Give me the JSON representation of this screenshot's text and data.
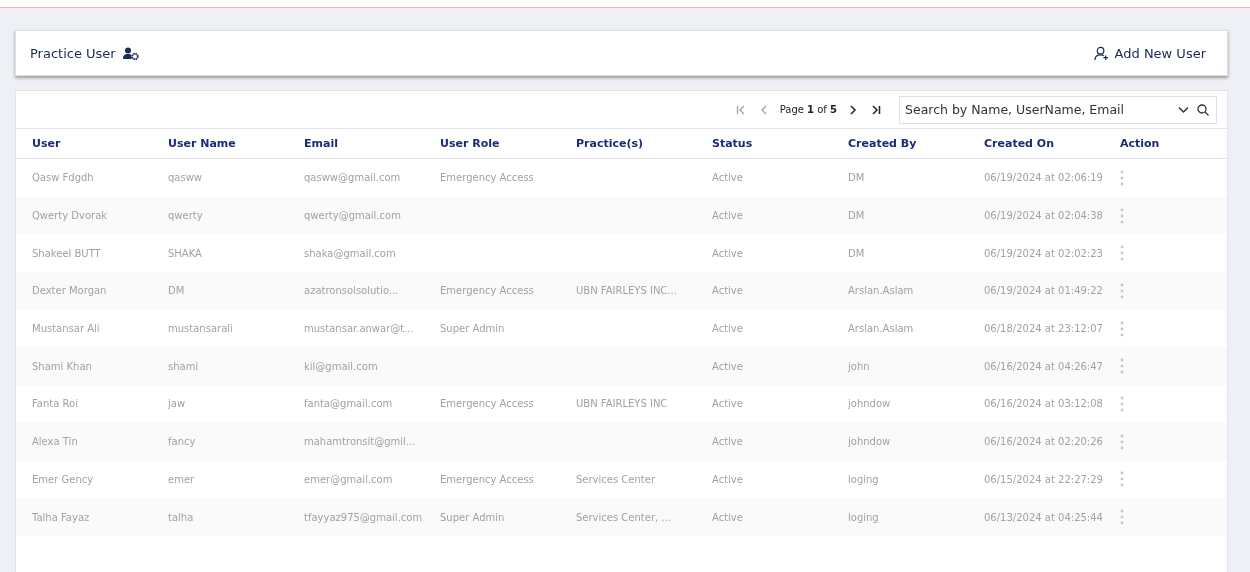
{
  "header": {
    "title": "Practice User",
    "add_button": "Add New User"
  },
  "pagination": {
    "label": "Page",
    "current": "1",
    "of": "of",
    "total": "5"
  },
  "search": {
    "placeholder": "Search by Name, UserName, Email"
  },
  "table": {
    "columns": [
      "User",
      "User Name",
      "Email",
      "User Role",
      "Practice(s)",
      "Status",
      "Created By",
      "Created On",
      "Action"
    ],
    "rows": [
      {
        "user": "Qasw Fdgdh",
        "user_name": "qasww",
        "email": "qasww@gmail.com",
        "user_role": "Emergency Access",
        "status": "Active",
        "created_by": "DM",
        "created_on": "06/19/2024 at 02:06:19"
      },
      {
        "user": "Qwerty Dvorak",
        "user_name": "qwerty",
        "email": "qwerty@gmail.com",
        "status": "Active",
        "created_by": "DM",
        "created_on": "06/19/2024 at 02:04:38"
      },
      {
        "user": "Shakeel BUTT",
        "user_name": "SHAKA",
        "email": "shaka@gmail.com",
        "status": "Active",
        "created_by": "DM",
        "created_on": "06/19/2024 at 02:02:23"
      },
      {
        "user": "Dexter Morgan",
        "user_name": "DM",
        "email": "azatronsolsolutio...",
        "user_role": "Emergency Access",
        "practices": "UBN FAIRLEYS INC...",
        "status": "Active",
        "created_by": "Arslan.Aslam",
        "created_on": "06/19/2024 at 01:49:22"
      },
      {
        "user": "Mustansar Ali",
        "user_name": "mustansarali",
        "email": "mustansar.anwar@t...",
        "user_role": "Super Admin",
        "status": "Active",
        "created_by": "Arslan.Aslam",
        "created_on": "06/18/2024 at 23:12:07"
      },
      {
        "user": "Shami Khan",
        "user_name": "shami",
        "email": "kil@gmail.com",
        "status": "Active",
        "created_by": "john",
        "created_on": "06/16/2024 at 04:26:47"
      },
      {
        "user": "Fanta Roi",
        "user_name": "jaw",
        "email": "fanta@gmail.com",
        "user_role": "Emergency Access",
        "practices": "UBN FAIRLEYS INC",
        "status": "Active",
        "created_by": "johndow",
        "created_on": "06/16/2024 at 03:12:08"
      },
      {
        "user": "Alexa Tin",
        "user_name": "fancy",
        "email": "mahamtronsit@gmil...",
        "status": "Active",
        "created_by": "johndow",
        "created_on": "06/16/2024 at 02:20:26"
      },
      {
        "user": "Emer Gency",
        "user_name": "emer",
        "email": "emer@gmail.com",
        "user_role": "Emergency Access",
        "practices": "Services Center",
        "status": "Active",
        "created_by": "loging",
        "created_on": "06/15/2024 at 22:27:29"
      },
      {
        "user": "Talha Fayaz",
        "user_name": "talha",
        "email": "tfayyaz975@gmail.com",
        "user_role": "Super Admin",
        "practices": "Services Center, ...",
        "status": "Active",
        "created_by": "loging",
        "created_on": "06/13/2024 at 04:25:44"
      }
    ]
  }
}
